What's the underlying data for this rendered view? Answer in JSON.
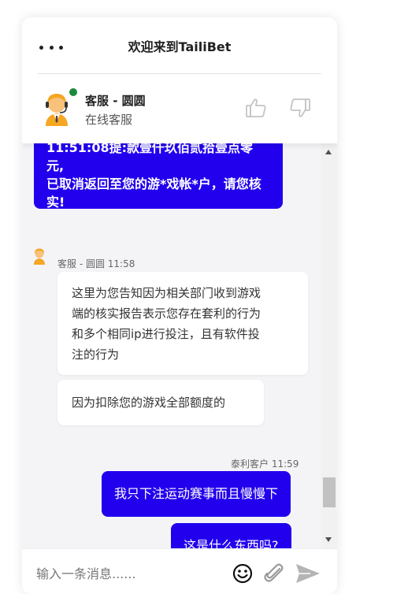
{
  "header": {
    "title": "欢迎来到TailiBet",
    "agent_name": "客服 - 圆圆",
    "agent_status": "在线客服"
  },
  "messages": {
    "prev_outgoing_partial": [
      "11:51:08提:款壹仟玖佰贰拾壹点零元,",
      "已取消返回至您的游*戏帐*户，请您核",
      "实!"
    ],
    "agent_meta": "客服 - 圆圆 11:58",
    "agent_msg_1": [
      "这里为您告知因为相关部门收到游戏",
      "端的核实报告表示您存在套利的行为",
      "和多个相同ip进行投注，且有软件投",
      "注的行为"
    ],
    "agent_msg_2": "因为扣除您的游戏全部额度的",
    "customer_meta": "泰利客户 11:59",
    "customer_msg_1": "我只下注运动赛事而且慢慢下",
    "customer_msg_2": "这是什么东西吗?"
  },
  "composer": {
    "placeholder": "输入一条消息......"
  },
  "colors": {
    "outgoing_bubble": "#2200ee",
    "online_dot": "#1c8a3a",
    "avatar_orange": "#f5a623"
  },
  "icons": [
    "menu-dots-icon",
    "agent-avatar-icon",
    "thumbs-up-icon",
    "thumbs-down-icon",
    "emoji-icon",
    "paperclip-icon",
    "send-icon"
  ]
}
